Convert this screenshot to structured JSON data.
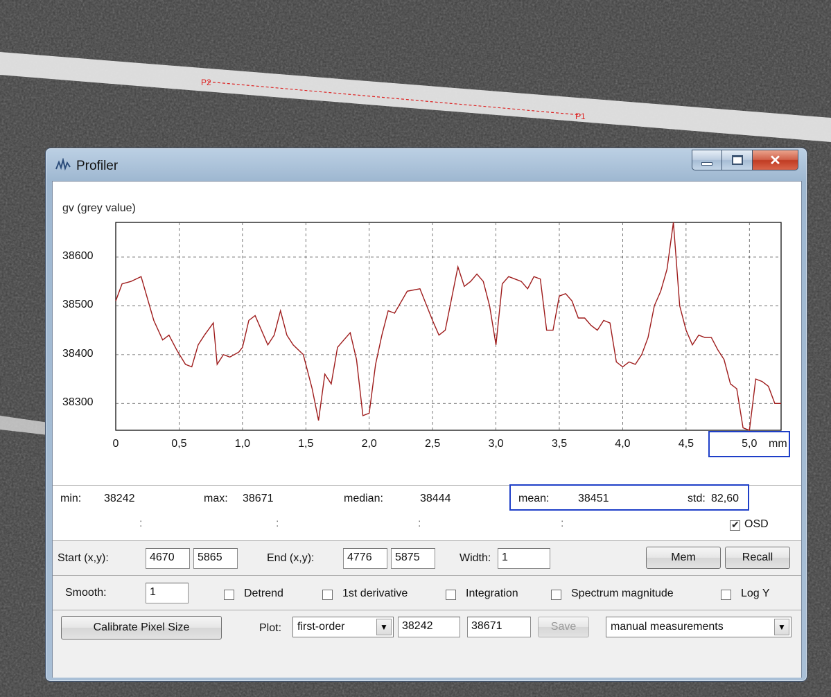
{
  "window": {
    "title": "Profiler"
  },
  "plot": {
    "ylabel": "gv (grey value)",
    "x_unit": "mm"
  },
  "chart_data": {
    "type": "line",
    "xlabel": "mm",
    "ylabel": "gv (grey value)",
    "xlim": [
      0,
      5.25
    ],
    "ylim": [
      38245,
      38671
    ],
    "grid": true,
    "x_ticks": [
      "0",
      "0,5",
      "1,0",
      "1,5",
      "2,0",
      "2,5",
      "3,0",
      "3,5",
      "4,0",
      "4,5",
      "5,0"
    ],
    "y_ticks": [
      "38300",
      "38400",
      "38500",
      "38600"
    ],
    "series": [
      {
        "color": "#9e1b1b",
        "x": [
          0,
          0.05,
          0.12,
          0.2,
          0.3,
          0.37,
          0.42,
          0.48,
          0.55,
          0.6,
          0.65,
          0.7,
          0.77,
          0.8,
          0.85,
          0.9,
          0.97,
          1.0,
          1.05,
          1.1,
          1.2,
          1.25,
          1.3,
          1.35,
          1.4,
          1.48,
          1.55,
          1.6,
          1.65,
          1.7,
          1.75,
          1.8,
          1.85,
          1.9,
          1.95,
          2.0,
          2.05,
          2.1,
          2.15,
          2.2,
          2.3,
          2.4,
          2.5,
          2.55,
          2.6,
          2.7,
          2.75,
          2.8,
          2.85,
          2.9,
          2.95,
          3.0,
          3.05,
          3.1,
          3.15,
          3.2,
          3.25,
          3.3,
          3.35,
          3.4,
          3.45,
          3.5,
          3.55,
          3.6,
          3.65,
          3.7,
          3.75,
          3.8,
          3.85,
          3.9,
          3.95,
          4.0,
          4.05,
          4.1,
          4.15,
          4.2,
          4.25,
          4.3,
          4.35,
          4.4,
          4.45,
          4.5,
          4.55,
          4.6,
          4.65,
          4.7,
          4.75,
          4.8,
          4.85,
          4.9,
          4.95,
          5.0,
          5.05,
          5.1,
          5.15,
          5.2,
          5.25
        ],
        "values": [
          38510,
          38545,
          38550,
          38560,
          38470,
          38430,
          38440,
          38410,
          38380,
          38375,
          38420,
          38440,
          38465,
          38380,
          38400,
          38395,
          38405,
          38415,
          38470,
          38480,
          38420,
          38440,
          38490,
          38440,
          38420,
          38400,
          38330,
          38265,
          38360,
          38340,
          38415,
          38430,
          38445,
          38390,
          38275,
          38280,
          38380,
          38440,
          38490,
          38485,
          38530,
          38535,
          38470,
          38440,
          38450,
          38580,
          38540,
          38550,
          38565,
          38550,
          38500,
          38420,
          38545,
          38560,
          38555,
          38550,
          38535,
          38560,
          38555,
          38450,
          38450,
          38520,
          38525,
          38510,
          38475,
          38475,
          38460,
          38450,
          38470,
          38465,
          38385,
          38375,
          38385,
          38380,
          38400,
          38435,
          38500,
          38530,
          38575,
          38671,
          38500,
          38450,
          38420,
          38440,
          38435,
          38435,
          38410,
          38390,
          38340,
          38330,
          38250,
          38245,
          38350,
          38345,
          38335,
          38300,
          38300
        ]
      }
    ]
  },
  "stats": {
    "min_label": "min:",
    "min_value": "38242",
    "max_label": "max:",
    "max_value": "38671",
    "median_label": "median:",
    "median_value": "38444",
    "mean_label": "mean:",
    "mean_value": "38451",
    "std_label": "std:",
    "std_value": "82,60"
  },
  "osd_row": {
    "colons": [
      ":",
      ":",
      ":",
      ":"
    ],
    "osd_label": "OSD",
    "osd_checked": true
  },
  "coords": {
    "start_label": "Start (x,y):",
    "start_x": "4670",
    "start_y": "5865",
    "end_label": "End (x,y):",
    "end_x": "4776",
    "end_y": "5875",
    "width_label": "Width:",
    "width_value": "1",
    "mem_label": "Mem",
    "recall_label": "Recall"
  },
  "options": {
    "smooth_label": "Smooth:",
    "smooth_value": "1",
    "detrend_label": "Detrend",
    "derivative_label": "1st derivative",
    "integration_label": "Integration",
    "spectrum_label": "Spectrum magnitude",
    "logy_label": "Log Y"
  },
  "bottom": {
    "calibrate_label": "Calibrate Pixel Size",
    "plot_label": "Plot:",
    "plot_selected": "first-order",
    "range_min": "38242",
    "range_max": "38671",
    "save_label": "Save",
    "mode_selected": "manual measurements"
  },
  "overlay": {
    "p2_label": "P2",
    "p1_label": "P1"
  }
}
